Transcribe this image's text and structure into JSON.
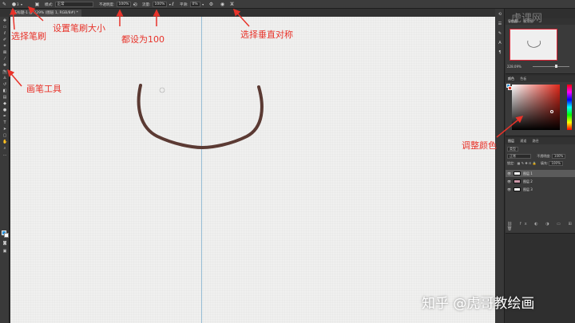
{
  "options_bar": {
    "brush_size": "3",
    "mode_label": "模式:",
    "mode_value": "正常",
    "opacity_label": "不透明度:",
    "opacity_value": "100%",
    "flow_label": "流量:",
    "flow_value": "100%",
    "smoothing_label": "平滑:",
    "smoothing_value": "0%"
  },
  "document_tab": {
    "title": "未标题-1 @ 229% (图层 1, RGB/8#) *"
  },
  "panels": {
    "navigator": {
      "tabs": [
        "导航器",
        "直方图"
      ],
      "zoom_value": "228.09%"
    },
    "color": {
      "tabs": [
        "颜色",
        "色板"
      ],
      "foreground": "#2f94d9",
      "background": "#e03a2a"
    },
    "layers": {
      "tabs": [
        "图层",
        "通道",
        "路径"
      ],
      "filter_label": "类型",
      "blend_mode": "正常",
      "opacity_label": "不透明度:",
      "opacity_value": "100%",
      "lock_label": "锁定:",
      "fill_label": "填充:",
      "fill_value": "100%",
      "items": [
        {
          "name": "图层 1",
          "selected": true
        },
        {
          "name": "图层 2",
          "selected": false
        },
        {
          "name": "图层 3",
          "selected": false
        }
      ]
    }
  },
  "annotations": {
    "select_brush": "选择笔刷",
    "set_brush_size": "设置笔刷大小",
    "set_to_100": "都设为100",
    "vertical_symmetry": "选择垂直对称",
    "brush_tool": "画笔工具",
    "adjust_color": "调整颜色"
  },
  "watermarks": {
    "bottom": "知乎 @虎哥教绘画",
    "top": "虎课网"
  },
  "colors": {
    "annotation": "#e8332a",
    "stroke": "#5b3a33",
    "guide": "#7fb0cf",
    "selection_accent": "#d23"
  }
}
